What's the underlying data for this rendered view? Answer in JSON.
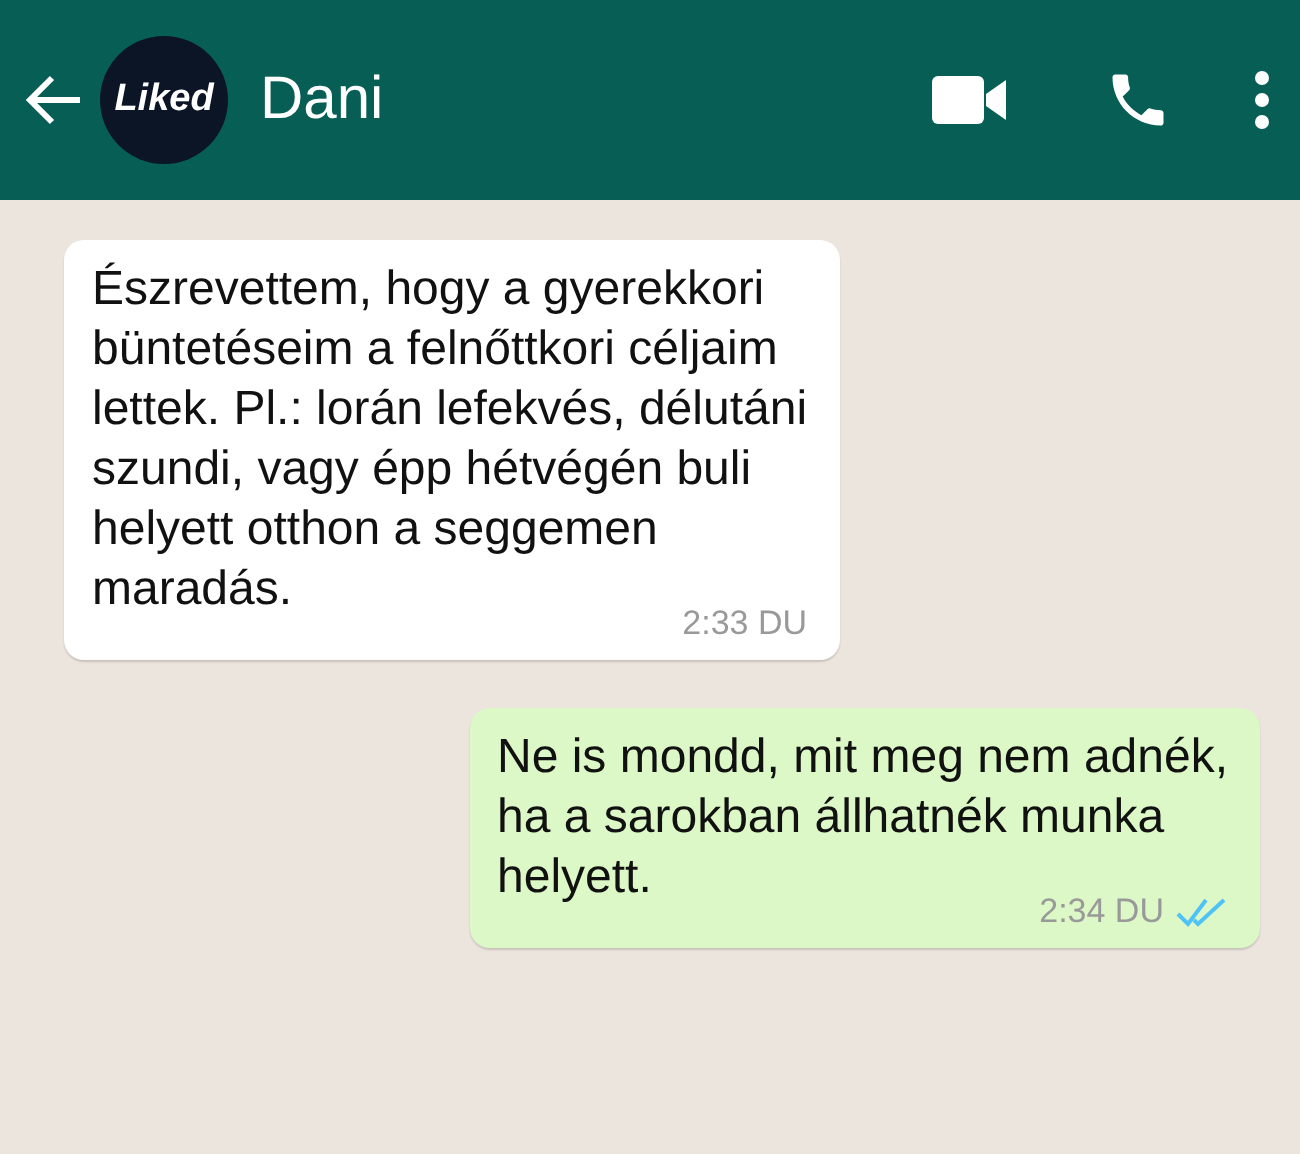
{
  "header": {
    "avatar_text": "Liked",
    "contact_name": "Dani"
  },
  "messages": [
    {
      "kind": "incoming",
      "text": "Észrevettem, hogy a gyerekkori\nbüntetéseim a felnőttkori céljaim\nlettek. Pl.: lorán lefekvés, délutáni\nszundi, vagy épp hétvégén buli\nhelyett otthon a seggemen\nmaradás.",
      "time": "2:33 DU"
    },
    {
      "kind": "outgoing",
      "text": "Ne is mondd, mit meg nem adnék,\nha a sarokban állhatnék munka\nhelyett.",
      "time": "2:34 DU",
      "read": true
    }
  ]
}
